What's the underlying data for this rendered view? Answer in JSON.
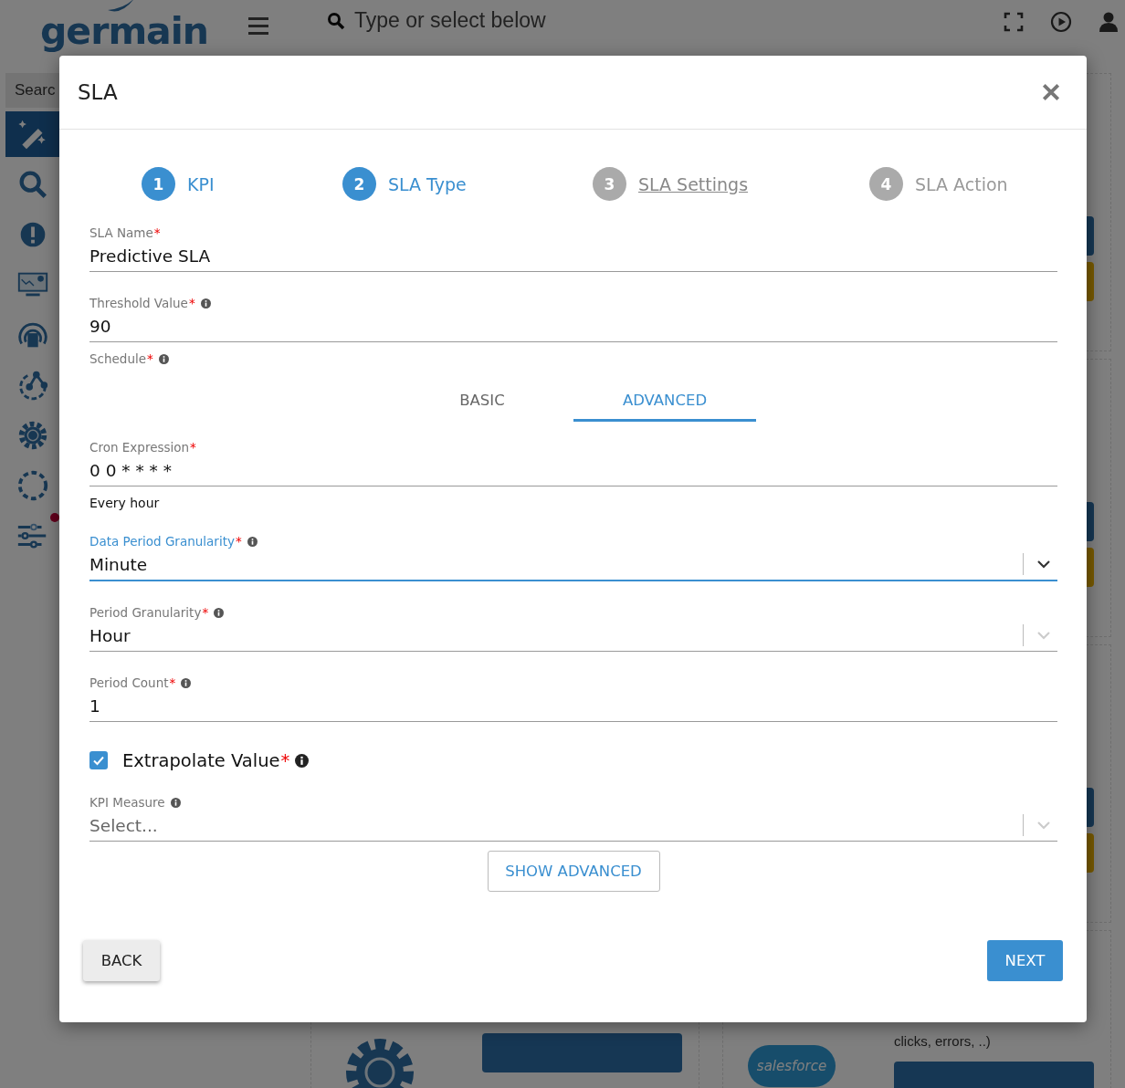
{
  "header": {
    "logo": "germain",
    "search_placeholder": "Type or select below"
  },
  "sidebar": {
    "search_placeholder": "Searc",
    "items": [
      {
        "selected": true,
        "notification": false
      },
      {
        "selected": false,
        "notification": false
      },
      {
        "selected": false,
        "notification": false
      },
      {
        "selected": false,
        "notification": false
      },
      {
        "selected": false,
        "notification": false
      },
      {
        "selected": false,
        "notification": false
      },
      {
        "selected": false,
        "notification": false
      },
      {
        "selected": false,
        "notification": false
      },
      {
        "selected": false,
        "notification": true
      }
    ]
  },
  "background_cards": {
    "logo_text": "salesforce",
    "description": "clicks, errors, ..)"
  },
  "dialog": {
    "title": "SLA",
    "steps": [
      {
        "number": "1",
        "label": "KPI",
        "completed": true,
        "selected": false
      },
      {
        "number": "2",
        "label": "SLA Type",
        "completed": true,
        "selected": false
      },
      {
        "number": "3",
        "label": "SLA Settings",
        "completed": false,
        "selected": true
      },
      {
        "number": "4",
        "label": "SLA Action",
        "completed": false,
        "selected": false
      }
    ],
    "fields": [
      {
        "kind": "text",
        "label": "SLA Name",
        "required_mark": "*",
        "info": false,
        "focused": false,
        "value": "Predictive SLA"
      },
      {
        "kind": "text",
        "label": "Threshold Value",
        "required_mark": "*",
        "info": true,
        "focused": false,
        "value": "90"
      },
      {
        "kind": "tabs",
        "label": "Schedule",
        "required_mark": "*",
        "info": true,
        "tabs": [
          {
            "label": "BASIC",
            "selected": false
          },
          {
            "label": "ADVANCED",
            "selected": true
          }
        ]
      },
      {
        "kind": "text",
        "label": "Cron Expression",
        "required_mark": "*",
        "info": false,
        "focused": false,
        "value": "0 0 * * * *",
        "hint": "Every hour"
      },
      {
        "kind": "select",
        "label": "Data Period Granularity",
        "required_mark": "*",
        "info": true,
        "focused": true,
        "value": "Minute"
      },
      {
        "kind": "select",
        "label": "Period Granularity",
        "required_mark": "*",
        "info": true,
        "focused": false,
        "value": "Hour"
      },
      {
        "kind": "text",
        "label": "Period Count",
        "required_mark": "*",
        "info": true,
        "focused": false,
        "value": "1"
      },
      {
        "kind": "checkbox",
        "label": "Extrapolate Value",
        "required_mark": "*",
        "info": true,
        "checked": true
      },
      {
        "kind": "select",
        "label": "KPI Measure",
        "info": true,
        "focused": false,
        "placeholder": "Select..."
      }
    ],
    "show_advanced": "SHOW ADVANCED",
    "back": "BACK",
    "next": "NEXT"
  }
}
